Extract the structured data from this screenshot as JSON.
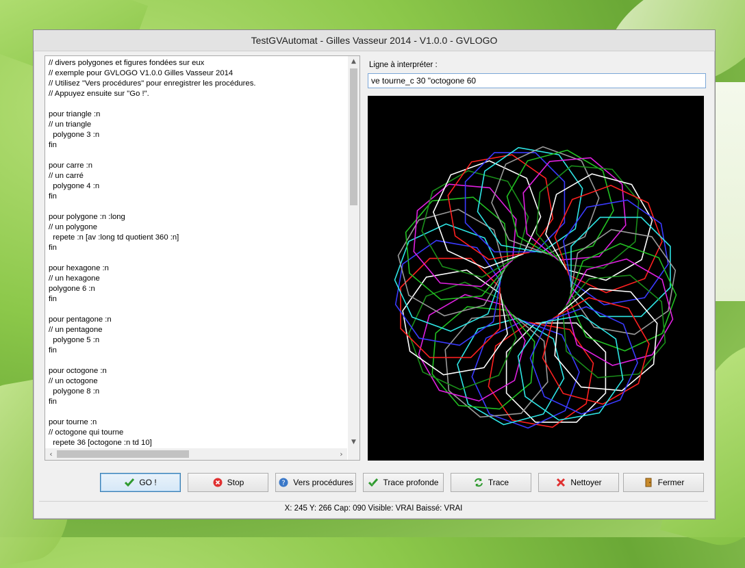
{
  "window": {
    "title": "TestGVAutomat - Gilles Vasseur 2014 - V1.0.0 - GVLOGO"
  },
  "editor": {
    "code_lines": [
      "// divers polygones et figures fondées sur eux",
      "// exemple pour GVLOGO V1.0.0 Gilles Vasseur 2014",
      "// Utilisez \"Vers procédures\" pour enregistrer les procédures.",
      "// Appuyez ensuite sur \"Go !\".",
      "",
      "pour triangle :n",
      "// un triangle",
      "  polygone 3 :n",
      "fin",
      "",
      "pour carre :n",
      "// un carré",
      "  polygone 4 :n",
      "fin",
      "",
      "pour polygone :n :long",
      "// un polygone",
      "  repete :n [av :long td quotient 360 :n]",
      "fin",
      "",
      "pour hexagone :n",
      "// un hexagone",
      "polygone 6 :n",
      "fin",
      "",
      "pour pentagone :n",
      "// un pentagone",
      "  polygone 5 :n",
      "fin",
      "",
      "pour octogone :n",
      "// un octogone",
      "  polygone 8 :n",
      "fin",
      "",
      "pour tourne :n",
      "// octogone qui tourne",
      "  repete 36 [octogone :n td 10]"
    ]
  },
  "interpreter": {
    "label": "Ligne à interpréter :",
    "value": "ve tourne_c 30 \"octogone 60"
  },
  "drawing": {
    "background": "#000000",
    "colors": [
      "#ffffff",
      "#ff2020",
      "#3a3aff",
      "#2ee6e6",
      "#9a9a9a",
      "#22c022",
      "#e020e0",
      "#1a8f1a"
    ]
  },
  "buttons": {
    "go": "GO !",
    "stop": "Stop",
    "procedures": "Vers procédures",
    "deep_trace": "Trace profonde",
    "trace": "Trace",
    "clear": "Nettoyer",
    "close": "Fermer"
  },
  "status": {
    "text": "X: 245 Y: 266 Cap: 090 Visible: VRAI Baissé: VRAI"
  },
  "scroll": {
    "up_glyph": "▲",
    "down_glyph": "▼",
    "left_glyph": "‹",
    "right_glyph": "›"
  }
}
